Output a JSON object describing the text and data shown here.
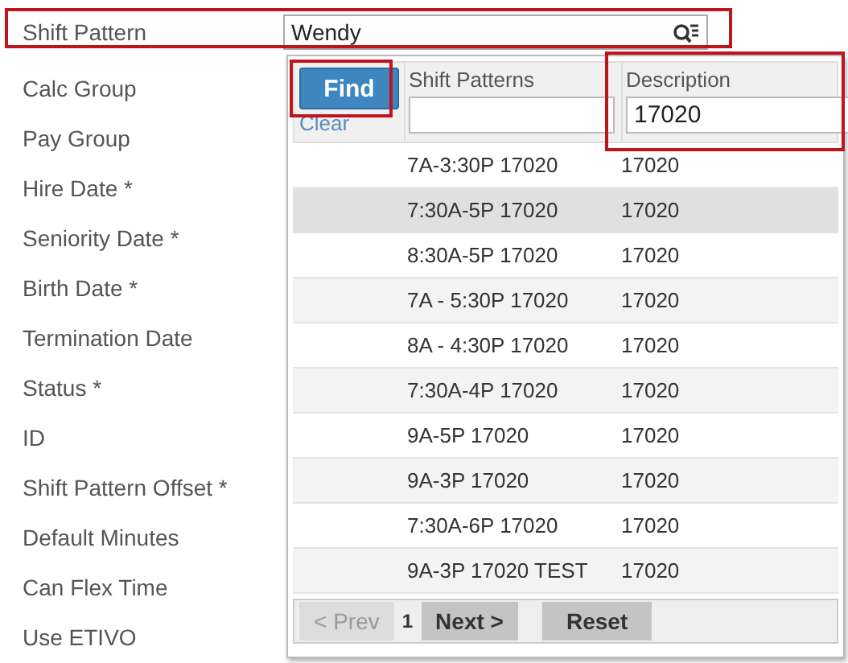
{
  "field": {
    "label": "Shift Pattern",
    "value": "Wendy"
  },
  "labels": [
    "Calc Group",
    "Pay Group",
    "Hire Date *",
    "Seniority Date *",
    "Birth Date *",
    "Termination Date",
    "Status *",
    "ID",
    "Shift Pattern Offset *",
    "Default Minutes",
    "Can Flex Time",
    "Use ETIVO"
  ],
  "lookup": {
    "find": "Find",
    "clear": "Clear",
    "columns": [
      {
        "title": "Shift Patterns"
      },
      {
        "title": "Description",
        "filter": "17020"
      }
    ],
    "rows": [
      {
        "pattern": "7A-3:30P 17020",
        "description": "17020",
        "selected": false
      },
      {
        "pattern": "7:30A-5P 17020",
        "description": "17020",
        "selected": true
      },
      {
        "pattern": "8:30A-5P 17020",
        "description": "17020",
        "selected": false
      },
      {
        "pattern": "7A - 5:30P 17020",
        "description": "17020",
        "selected": false
      },
      {
        "pattern": "8A - 4:30P 17020",
        "description": "17020",
        "selected": false
      },
      {
        "pattern": "7:30A-4P 17020",
        "description": "17020",
        "selected": false
      },
      {
        "pattern": "9A-5P 17020",
        "description": "17020",
        "selected": false
      },
      {
        "pattern": "9A-3P 17020",
        "description": "17020",
        "selected": false
      },
      {
        "pattern": "7:30A-6P 17020",
        "description": "17020",
        "selected": false
      },
      {
        "pattern": "9A-3P 17020 TEST",
        "description": "17020",
        "selected": false
      }
    ],
    "pager": {
      "prev": {
        "label": "< Prev",
        "disabled": true
      },
      "page": "1",
      "next": {
        "label": "Next >",
        "disabled": false
      },
      "reset": "Reset"
    }
  }
}
